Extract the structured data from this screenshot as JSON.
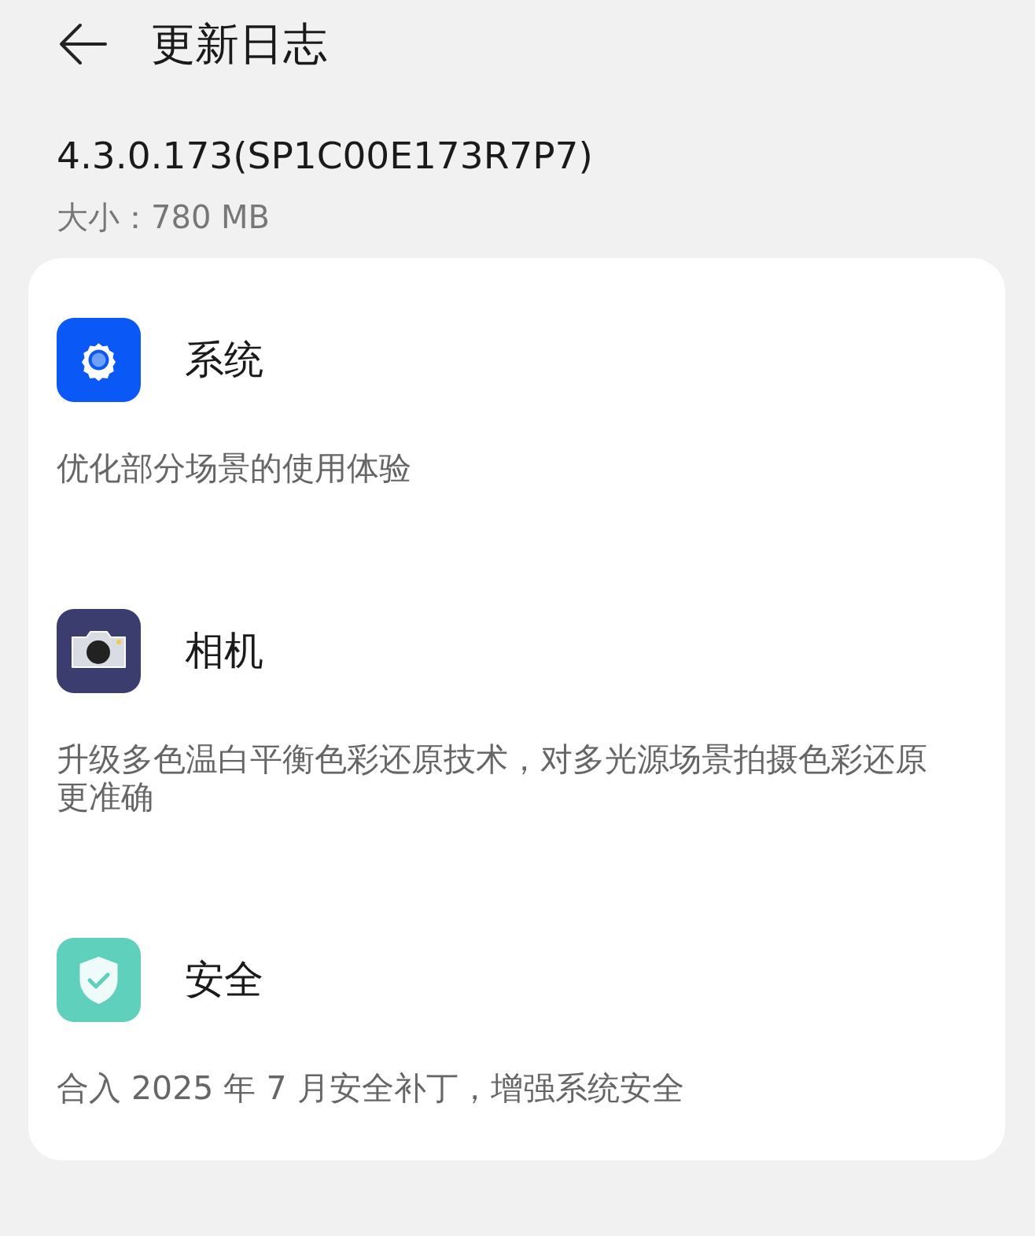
{
  "header": {
    "title": "更新日志"
  },
  "version": "4.3.0.173(SP1C00E173R7P7)",
  "size": "大小：780 MB",
  "sections": [
    {
      "kind": "system",
      "title": "系统",
      "description": "优化部分场景的使用体验"
    },
    {
      "kind": "camera",
      "title": "相机",
      "description": "升级多色温白平衡色彩还原技术，对多光源场景拍摄色彩还原更准确"
    },
    {
      "kind": "security",
      "title": "安全",
      "description": "合入 2025 年 7 月安全补丁，增强系统安全"
    }
  ]
}
